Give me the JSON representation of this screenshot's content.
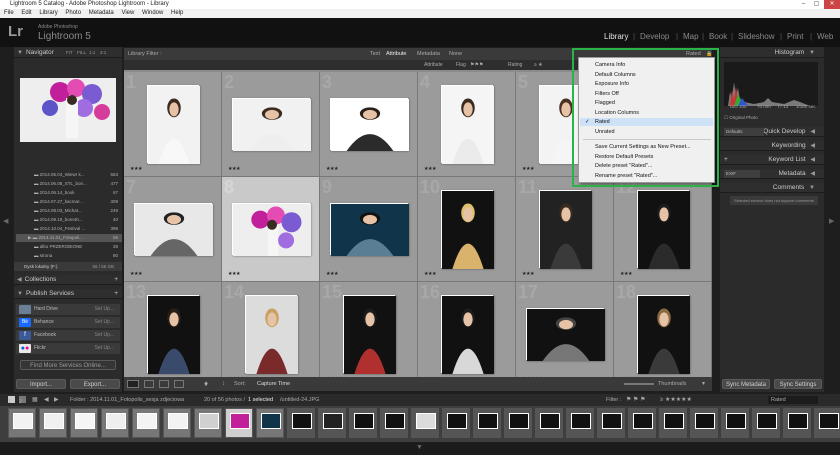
{
  "window": {
    "title": "Lightroom 5 Catalog - Adobe Photoshop Lightroom - Library"
  },
  "menu": [
    "File",
    "Edit",
    "Library",
    "Photo",
    "Metadata",
    "View",
    "Window",
    "Help"
  ],
  "identity": {
    "logo": "Lr",
    "sub": "Adobe Photoshop",
    "name": "Lightroom 5"
  },
  "modules": [
    "Library",
    "Develop",
    "Map",
    "Book",
    "Slideshow",
    "Print",
    "Web"
  ],
  "active_module": "Library",
  "left_panel": {
    "navigator_label": "Navigator",
    "nav_modes": [
      "FIT",
      "FILL",
      "1:1",
      "3:1"
    ],
    "folders": [
      {
        "name": "2014.05.04_Wiewr k...",
        "count": "563"
      },
      {
        "name": "2014.06.08_STL_bon...",
        "count": "477"
      },
      {
        "name": "2014.06.14_book",
        "count": "67"
      },
      {
        "name": "2014.07.27_kacmar...",
        "count": "309"
      },
      {
        "name": "2014.08.03_Michat...",
        "count": "249"
      },
      {
        "name": "2014.09.19_bore40...",
        "count": "40"
      },
      {
        "name": "2014.10.04_Festival ...",
        "count": "398"
      },
      {
        "name": "2014.11.01_Fotopoli...",
        "count": "56"
      },
      {
        "name": "albo PRZEROBIONE",
        "count": "28"
      },
      {
        "name": "strona",
        "count": "80"
      }
    ],
    "volume": {
      "name": "Dysk lokalny (F:)",
      "info": "56 / 56 GB"
    },
    "collections_label": "Collections",
    "publish_label": "Publish Services",
    "publish": [
      {
        "name": "Hard Drive",
        "action": "Set Up...",
        "color": "#6a7f95"
      },
      {
        "name": "Behance",
        "action": "Set Up...",
        "color": "#1769ff"
      },
      {
        "name": "Facebook",
        "action": "Set Up...",
        "color": "#3b5998"
      },
      {
        "name": "Flickr",
        "action": "Set Up...",
        "color": "#e8e8e8"
      }
    ],
    "find_more": "Find More Services Online...",
    "import_label": "Import...",
    "export_label": "Export..."
  },
  "filter_bar": {
    "title": "Library Filter :",
    "tabs": [
      "Text",
      "Attribute",
      "Metadata",
      "None"
    ],
    "preset": "Rated"
  },
  "attr_bar": {
    "attribute": "Attribute",
    "flag": "Flag",
    "rating": "Rating",
    "color": "Color",
    "kind": "Kind"
  },
  "dropdown": {
    "items": [
      "Camera Info",
      "Default Columns",
      "Exposure Info",
      "Filters Off",
      "Flagged",
      "Location Columns",
      "Rated",
      "Unrated"
    ],
    "checked": "Rated",
    "actions": [
      "Save Current Settings as New Preset...",
      "Restore Default Presets",
      "Delete preset \"Rated\"...",
      "Rename preset \"Rated\"..."
    ]
  },
  "grid": {
    "numbers": [
      "1",
      "2",
      "3",
      "4",
      "5",
      "6",
      "7",
      "8",
      "9",
      "10",
      "11",
      "12",
      "13",
      "14",
      "15",
      "16",
      "17",
      "18"
    ],
    "stars": [
      "★★★",
      "★★★",
      "★★★",
      "★★★",
      "★★★",
      "★★★",
      "★★★",
      "★★★",
      "★★★",
      "★★★",
      "★★★",
      "★★★",
      "★★★★★",
      "★★★★★",
      "★★★★★",
      "★★★★★",
      "★★★★★",
      "★★★★★"
    ]
  },
  "toolbar": {
    "sort_label": "Sort:",
    "sort_value": "Capture Time",
    "thumbs": "Thumbnails"
  },
  "right_panel": {
    "histogram": "Histogram",
    "hist_info": [
      "ISO 100",
      "70 mm",
      "f / 13",
      "1/160 sec"
    ],
    "original": "Original Photo",
    "quick_develop": "Quick Develop",
    "custom": "Defaults",
    "keywording": "Keywording",
    "keyword_list": "Keyword List",
    "metadata": "Metadata",
    "metadata_preset": "EXIF",
    "comments": "Comments",
    "comments_note": "Selected service does not support comments",
    "sync_metadata": "Sync Metadata",
    "sync_settings": "Sync Settings"
  },
  "filmstrip": {
    "pages": [
      "1",
      "2"
    ],
    "path": "Folder : 2014.11.01_Fotopolis_sesja zdjeciowa",
    "count": "20 of 56 photos /",
    "selected": "1 selected",
    "file": "/untitled-24.JPG",
    "filter_label": "Filter :",
    "rated": "Rated"
  },
  "colors": {
    "accent": "#2bb34a",
    "menu_hl": "#cde1f7"
  }
}
